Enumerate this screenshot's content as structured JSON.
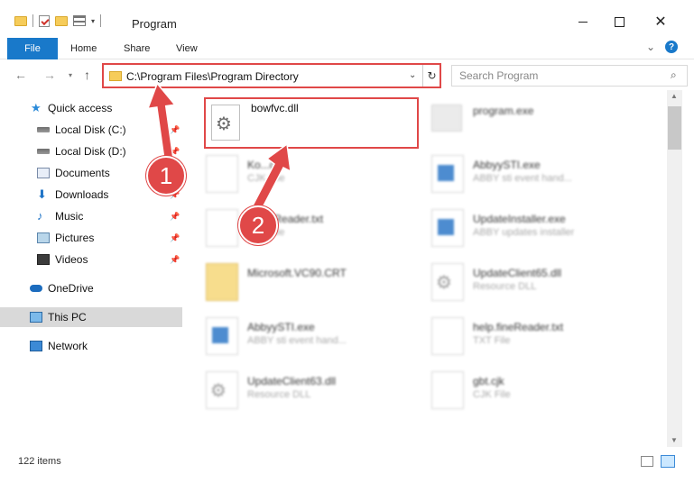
{
  "window": {
    "title": "Program",
    "controls": {
      "minimize": "minimize",
      "maximize": "maximize",
      "close": "✕"
    }
  },
  "ribbon": {
    "tabs": [
      {
        "label": "File"
      },
      {
        "label": "Home"
      },
      {
        "label": "Share"
      },
      {
        "label": "View"
      }
    ],
    "help": "?"
  },
  "nav": {
    "address": "C:\\Program Files\\Program Directory",
    "search_placeholder": "Search Program"
  },
  "sidebar": {
    "items": [
      {
        "label": "Quick access",
        "icon": "star-icon",
        "pinned": false
      },
      {
        "label": "Local Disk (C:)",
        "icon": "drive-icon",
        "pinned": true
      },
      {
        "label": "Local Disk (D:)",
        "icon": "drive-icon",
        "pinned": true
      },
      {
        "label": "Documents",
        "icon": "documents-icon",
        "pinned": true
      },
      {
        "label": "Downloads",
        "icon": "download-icon",
        "pinned": true
      },
      {
        "label": "Music",
        "icon": "music-icon",
        "pinned": true
      },
      {
        "label": "Pictures",
        "icon": "pictures-icon",
        "pinned": true
      },
      {
        "label": "Videos",
        "icon": "videos-icon",
        "pinned": true
      },
      {
        "label": "OneDrive",
        "icon": "cloud-icon",
        "pinned": false
      },
      {
        "label": "This PC",
        "icon": "pc-icon",
        "pinned": false
      },
      {
        "label": "Network",
        "icon": "network-icon",
        "pinned": false
      }
    ]
  },
  "files": {
    "highlighted": {
      "name": "bowfvc.dll"
    },
    "left": [
      {
        "name": "Ko...cjk",
        "sub": "CJK File"
      },
      {
        "name": "...fineReader.txt",
        "sub": "TXT File"
      },
      {
        "name": "Microsoft.VC90.CRT",
        "sub": ""
      },
      {
        "name": "AbbyySTI.exe",
        "sub": "ABBY sti event hand..."
      },
      {
        "name": "UpdateClient63.dll",
        "sub": "Resource DLL"
      }
    ],
    "right": [
      {
        "name": "program.exe",
        "sub": ""
      },
      {
        "name": "AbbyySTI.exe",
        "sub": "ABBY sti event hand..."
      },
      {
        "name": "UpdateInstaller.exe",
        "sub": "ABBY updates installer"
      },
      {
        "name": "UpdateClient65.dll",
        "sub": "Resource DLL"
      },
      {
        "name": "help.fineReader.txt",
        "sub": "TXT File"
      },
      {
        "name": "gbt.cjk",
        "sub": "CJK File"
      }
    ]
  },
  "status": {
    "item_count": "122 items"
  },
  "annotations": {
    "step1": "1",
    "step2": "2",
    "accent_color": "#e04848"
  }
}
